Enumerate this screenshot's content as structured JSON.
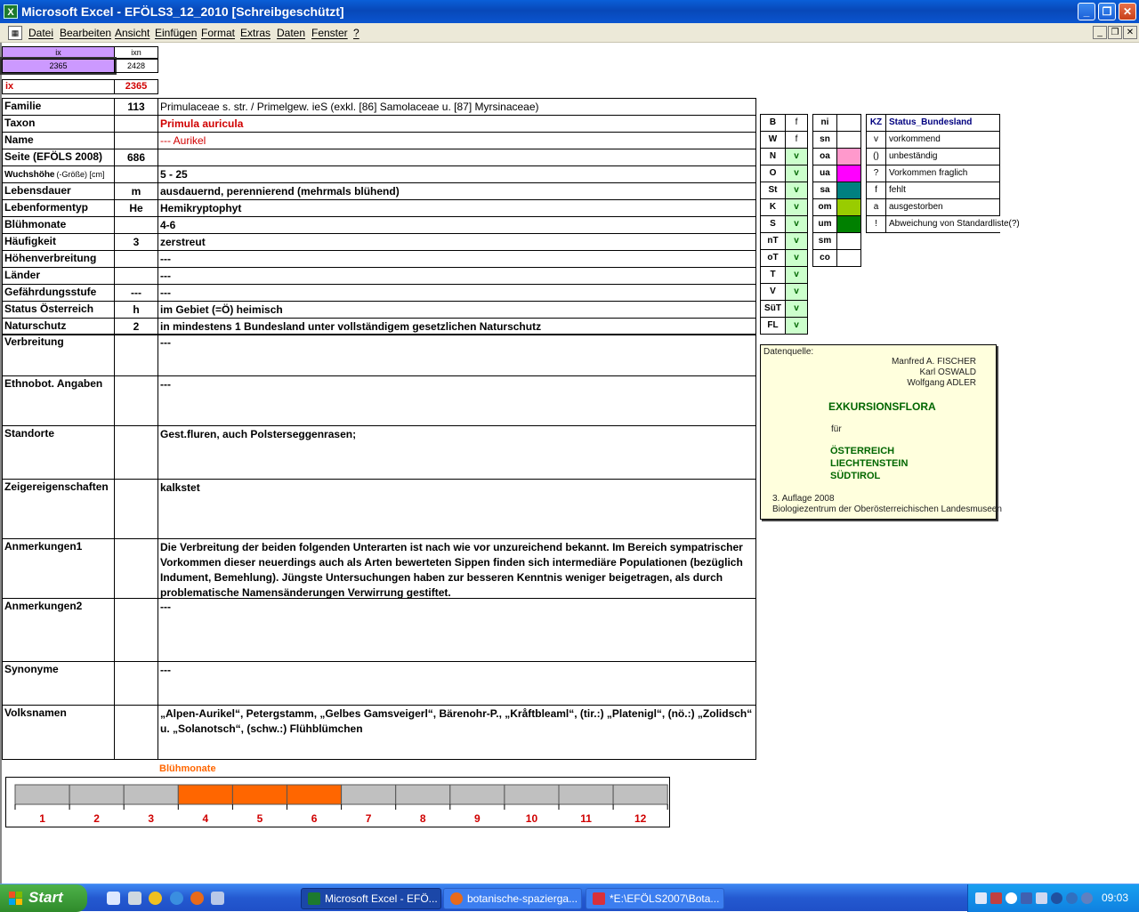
{
  "window": {
    "title": "Microsoft Excel - EFÖLS3_12_2010  [Schreibgeschützt]"
  },
  "menu": [
    "Datei",
    "Bearbeiten",
    "Ansicht",
    "Einfügen",
    "Format",
    "Extras",
    "Daten",
    "Fenster",
    "?"
  ],
  "topcells": {
    "ix_head": "ix",
    "ixn_head": "ixn",
    "ix_val": "2365",
    "ixn_val": "2428",
    "ix_label": "ix",
    "ix_red_val": "2365"
  },
  "fields": [
    {
      "label": "Familie",
      "num": "113",
      "value": "Primulaceae s. str.  /  Primelgew. ieS (exkl. [86] Samolaceae u. [87] Myrsinaceae)"
    },
    {
      "label": "Taxon",
      "num": "",
      "value": "Primula auricula"
    },
    {
      "label": "Name",
      "num": "",
      "value": "--- Aurikel"
    },
    {
      "label": "Seite (EFÖLS 2008)",
      "num": "686",
      "value": ""
    },
    {
      "label": "Wuchshöhe",
      "label_suffix": "(-Größe) [cm]",
      "num": "",
      "value": " 5 - 25"
    },
    {
      "label": "Lebensdauer",
      "num": "m",
      "value": "ausdauernd, perennierend (mehrmals blühend)"
    },
    {
      "label": "Lebenformentyp",
      "num": "He",
      "value": "Hemikryptophyt"
    },
    {
      "label": "Blühmonate",
      "num": "",
      "value": " 4-6"
    },
    {
      "label": "Häufigkeit",
      "num": "3",
      "value": "zerstreut"
    },
    {
      "label": "Höhenverbreitung",
      "num": "",
      "value": " ---"
    },
    {
      "label": "Länder",
      "num": "",
      "value": " ---"
    },
    {
      "label": "Gefährdungsstufe",
      "num": "---",
      "value": "   ---"
    },
    {
      "label": "Status Österreich",
      "num": "h",
      "value": "im Gebiet (=Ö) heimisch"
    },
    {
      "label": "Naturschutz",
      "num": "2",
      "value": "in mindestens 1 Bundesland unter vollständigem gesetzlichen Naturschutz"
    }
  ],
  "blocks": [
    {
      "label": "Verbreitung",
      "value": " ---"
    },
    {
      "label": "Ethnobot. Angaben",
      "value": "---"
    },
    {
      "label": "Standorte",
      "value": "Gest.fluren, auch Polsterseggenrasen;"
    },
    {
      "label": "Zeigereigenschaften",
      "value": "kalkstet"
    },
    {
      "label": "Anmerkungen1",
      "value": "Die Verbreitung der beiden folgenden Unterarten ist nach wie vor unzureichend bekannt. Im Bereich sympatrischer Vorkommen dieser neuerdings auch als Arten bewerteten Sippen finden sich intermediäre Populationen (bezüglich Indument, Bemehlung). Jüngste Untersuchungen haben zur besseren Kenntnis weniger beigetragen, als durch problematische Namensänderungen Verwirrung gestiftet."
    },
    {
      "label": "Anmerkungen2",
      "value": "---"
    },
    {
      "label": "Synonyme",
      "value": "---"
    },
    {
      "label": "Volksnamen",
      "value": "„Alpen-Aurikel“, Petergstamm, „Gelbes Gamsveigerl“, Bärenohr-P., „Kråftbleaml“, (tir.:) „Platenigl“, (nö.:) „Zolidsch“ u. „Solanotsch“, (schw.:) Flühblümchen"
    }
  ],
  "bundesland": [
    {
      "k": "B",
      "v": "f"
    },
    {
      "k": "W",
      "v": "f"
    },
    {
      "k": "N",
      "v": "v"
    },
    {
      "k": "O",
      "v": "v"
    },
    {
      "k": "St",
      "v": "v"
    },
    {
      "k": "K",
      "v": "v"
    },
    {
      "k": "S",
      "v": "v"
    },
    {
      "k": "nT",
      "v": "v"
    },
    {
      "k": "oT",
      "v": "v"
    },
    {
      "k": "T",
      "v": "v"
    },
    {
      "k": "V",
      "v": "v"
    },
    {
      "k": "SüT",
      "v": "v"
    },
    {
      "k": "FL",
      "v": "v"
    }
  ],
  "alpine": [
    {
      "k": "ni",
      "color": "#ffffff"
    },
    {
      "k": "sn",
      "color": "#ffffff"
    },
    {
      "k": "oa",
      "color": "#ff99cc"
    },
    {
      "k": "ua",
      "color": "#ff00ff"
    },
    {
      "k": "sa",
      "color": "#008080"
    },
    {
      "k": "om",
      "color": "#99cc00"
    },
    {
      "k": "um",
      "color": "#008000"
    },
    {
      "k": "sm",
      "color": "#ffffff"
    },
    {
      "k": "co",
      "color": "#ffffff"
    }
  ],
  "status_legend": {
    "head_kz": "KZ",
    "head_text": "Status_Bundesland",
    "rows": [
      {
        "kz": "v",
        "text": "vorkommend"
      },
      {
        "kz": "()",
        "text": "unbeständig"
      },
      {
        "kz": "?",
        "text": "Vorkommen fraglich"
      },
      {
        "kz": "f",
        "text": "fehlt"
      },
      {
        "kz": "a",
        "text": "ausgestorben"
      },
      {
        "kz": "!",
        "text": "Abweichung von Standardliste(?)"
      }
    ]
  },
  "source": {
    "label": "Datenquelle:",
    "authors": [
      "Manfred A. FISCHER",
      "Karl OSWALD",
      "Wolfgang ADLER"
    ],
    "title": "EXKURSIONSFLORA",
    "fuer": "für",
    "countries": [
      "ÖSTERREICH",
      "LIECHTENSTEIN",
      "SÜDTIROL"
    ],
    "edition": "3. Auflage 2008",
    "publisher": "Biologiezentrum der Oberösterreichischen Landesmuseen"
  },
  "bloom": {
    "title": "Blühmonate",
    "months": [
      "1",
      "2",
      "3",
      "4",
      "5",
      "6",
      "7",
      "8",
      "9",
      "10",
      "11",
      "12"
    ],
    "active": [
      4,
      5,
      6
    ],
    "active_color": "#ff6600",
    "inactive_color": "#c0c0c0"
  },
  "taskbar": {
    "start": "Start",
    "buttons": [
      "Microsoft Excel - EFÖ...",
      "botanische-spazierga...",
      "*E:\\EFÖLS2007\\Bota..."
    ],
    "clock": "09:03"
  }
}
